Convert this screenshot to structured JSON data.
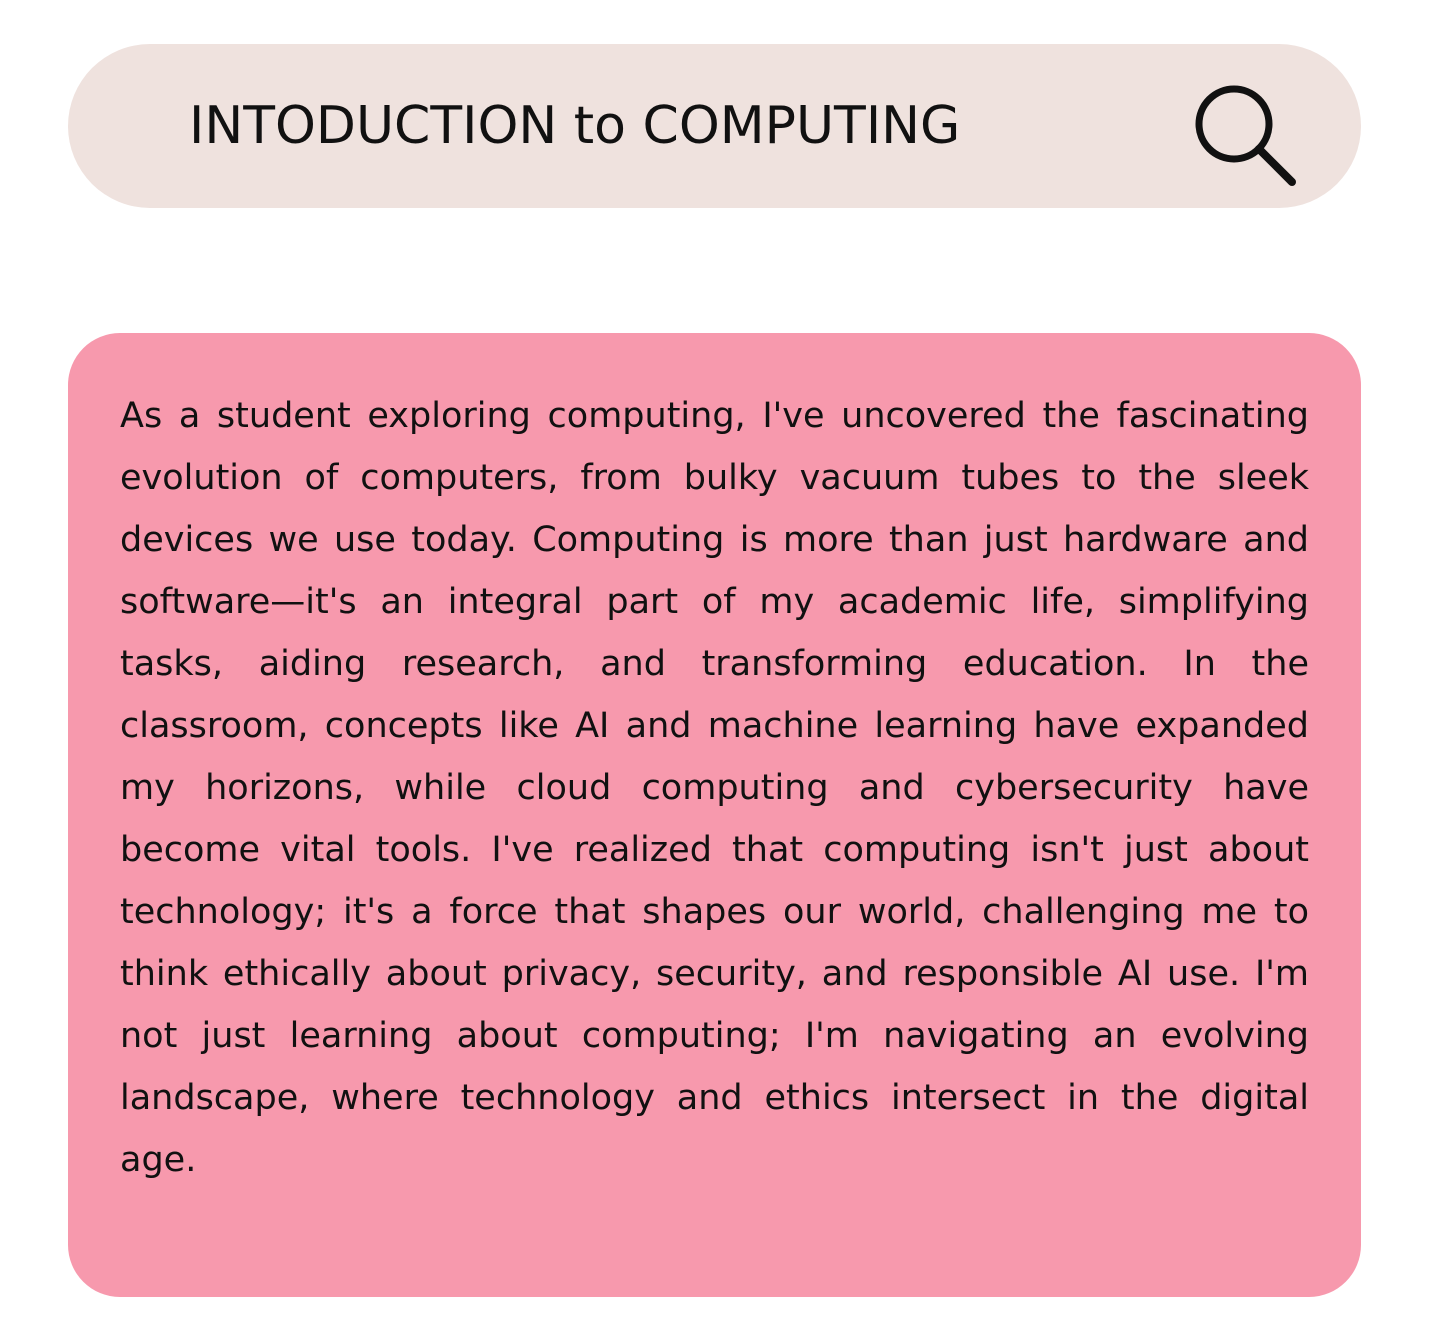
{
  "search": {
    "query": "INTODUCTION to COMPUTING",
    "icon": "search-icon"
  },
  "card": {
    "paragraph": "As a student exploring computing, I've uncovered the fascinating evolution of computers, from bulky vacuum tubes to the sleek devices we use today. Computing is more than just hardware and software—it's an integral part of my academic life, simplifying tasks, aiding research, and transforming education. In the classroom, concepts like AI and machine learning have expanded my horizons, while cloud computing and cybersecurity have become vital tools. I've realized that computing isn't just about technology; it's a force that shapes our world, challenging me to think ethically about privacy, security, and responsible AI use. I'm not just learning about computing; I'm navigating an evolving landscape, where technology and ethics intersect in the digital age."
  },
  "colors": {
    "search_bar_bg": "#efe2de",
    "card_bg": "#f799ad",
    "text": "#111111"
  }
}
